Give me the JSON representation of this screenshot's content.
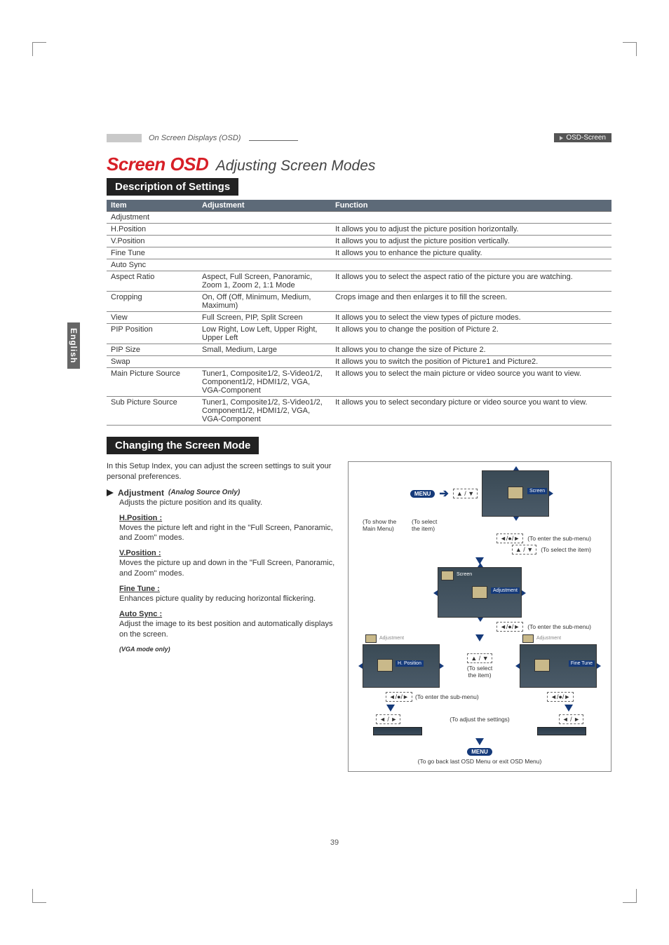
{
  "header": {
    "breadcrumb": "On Screen Displays (OSD)",
    "badge": "OSD-Screen"
  },
  "title": {
    "main": "Screen OSD",
    "sub": "Adjusting Screen Modes"
  },
  "sections": {
    "description": "Description of Settings",
    "changing": "Changing the Screen Mode"
  },
  "table": {
    "headers": {
      "item": "Item",
      "adjustment": "Adjustment",
      "function": "Function"
    },
    "rows": [
      {
        "item": "Adjustment",
        "adjustment": "",
        "function": ""
      },
      {
        "item": "H.Position",
        "adjustment": "",
        "function": "It allows you to adjust the picture position horizontally."
      },
      {
        "item": "V.Position",
        "adjustment": "",
        "function": "It allows you to adjust the picture position vertically."
      },
      {
        "item": "Fine Tune",
        "adjustment": "",
        "function": "It allows you to enhance the picture quality."
      },
      {
        "item": "Auto Sync",
        "adjustment": "",
        "function": ""
      },
      {
        "item": "Aspect Ratio",
        "adjustment": "Aspect, Full Screen, Panoramic, Zoom 1, Zoom 2, 1:1 Mode",
        "function": "It allows you to select the aspect ratio of the picture you are watching."
      },
      {
        "item": "Cropping",
        "adjustment": "On, Off (Off, Minimum, Medium, Maximum)",
        "function": "Crops image and then enlarges it to fill the screen."
      },
      {
        "item": "View",
        "adjustment": "Full Screen, PIP, Split Screen",
        "function": "It allows you to select the view types of picture modes."
      },
      {
        "item": "PIP Position",
        "adjustment": "Low Right, Low Left, Upper Right, Upper Left",
        "function": "It allows you to change the position of Picture 2."
      },
      {
        "item": "PIP Size",
        "adjustment": "Small, Medium, Large",
        "function": "It allows you to change the size of Picture 2."
      },
      {
        "item": "Swap",
        "adjustment": "",
        "function": "It allows you to switch the position of Picture1 and Picture2."
      },
      {
        "item": "Main Picture Source",
        "adjustment": "Tuner1, Composite1/2, S-Video1/2, Component1/2, HDMI1/2, VGA, VGA-Component",
        "function": "It allows you to select the main picture or video source you want to view."
      },
      {
        "item": "Sub Picture Source",
        "adjustment": "Tuner1, Composite1/2, S-Video1/2, Component1/2, HDMI1/2, VGA, VGA-Component",
        "function": "It allows you to select secondary picture or video source you want to view."
      }
    ]
  },
  "changing": {
    "intro": "In this Setup Index, you can adjust the screen settings to suit your personal preferences.",
    "adj_title": "Adjustment",
    "adj_only": "(Analog Source Only)",
    "adj_desc": "Adjusts the picture position and its quality.",
    "hpos_label": "H.Position :",
    "hpos_desc": "Moves the picture left and right in the \"Full Screen, Panoramic, and Zoom\" modes.",
    "vpos_label": "V.Position :",
    "vpos_desc": "Moves the picture up and down in the \"Full Screen, Panoramic, and Zoom\" modes.",
    "fine_label": "Fine Tune :",
    "fine_desc": "Enhances picture quality by reducing horizontal flickering.",
    "auto_label": "Auto Sync :",
    "auto_desc": "Adjust the image to its best position and automatically displays on the screen.",
    "vga_note": "(VGA mode only)"
  },
  "flow": {
    "menu": "MENU",
    "updown": "▲ / ▼",
    "leftright": "◄ / ►",
    "enter": "◄/●/►",
    "to_show_main": "(To show the Main Menu)",
    "to_select_item": "(To select the item)",
    "to_enter_sub": "(To enter the sub-menu)",
    "to_select_the_item": "(To select the item)",
    "to_adjust": "(To adjust the settings)",
    "to_go_back": "(To go back last OSD Menu or exit OSD Menu)",
    "screen_label": "Screen",
    "adjustment_label": "Adjustment",
    "hpos_label": "H. Position",
    "finetune_label": "Fine Tune"
  },
  "sidebar": "English",
  "page_number": "39"
}
